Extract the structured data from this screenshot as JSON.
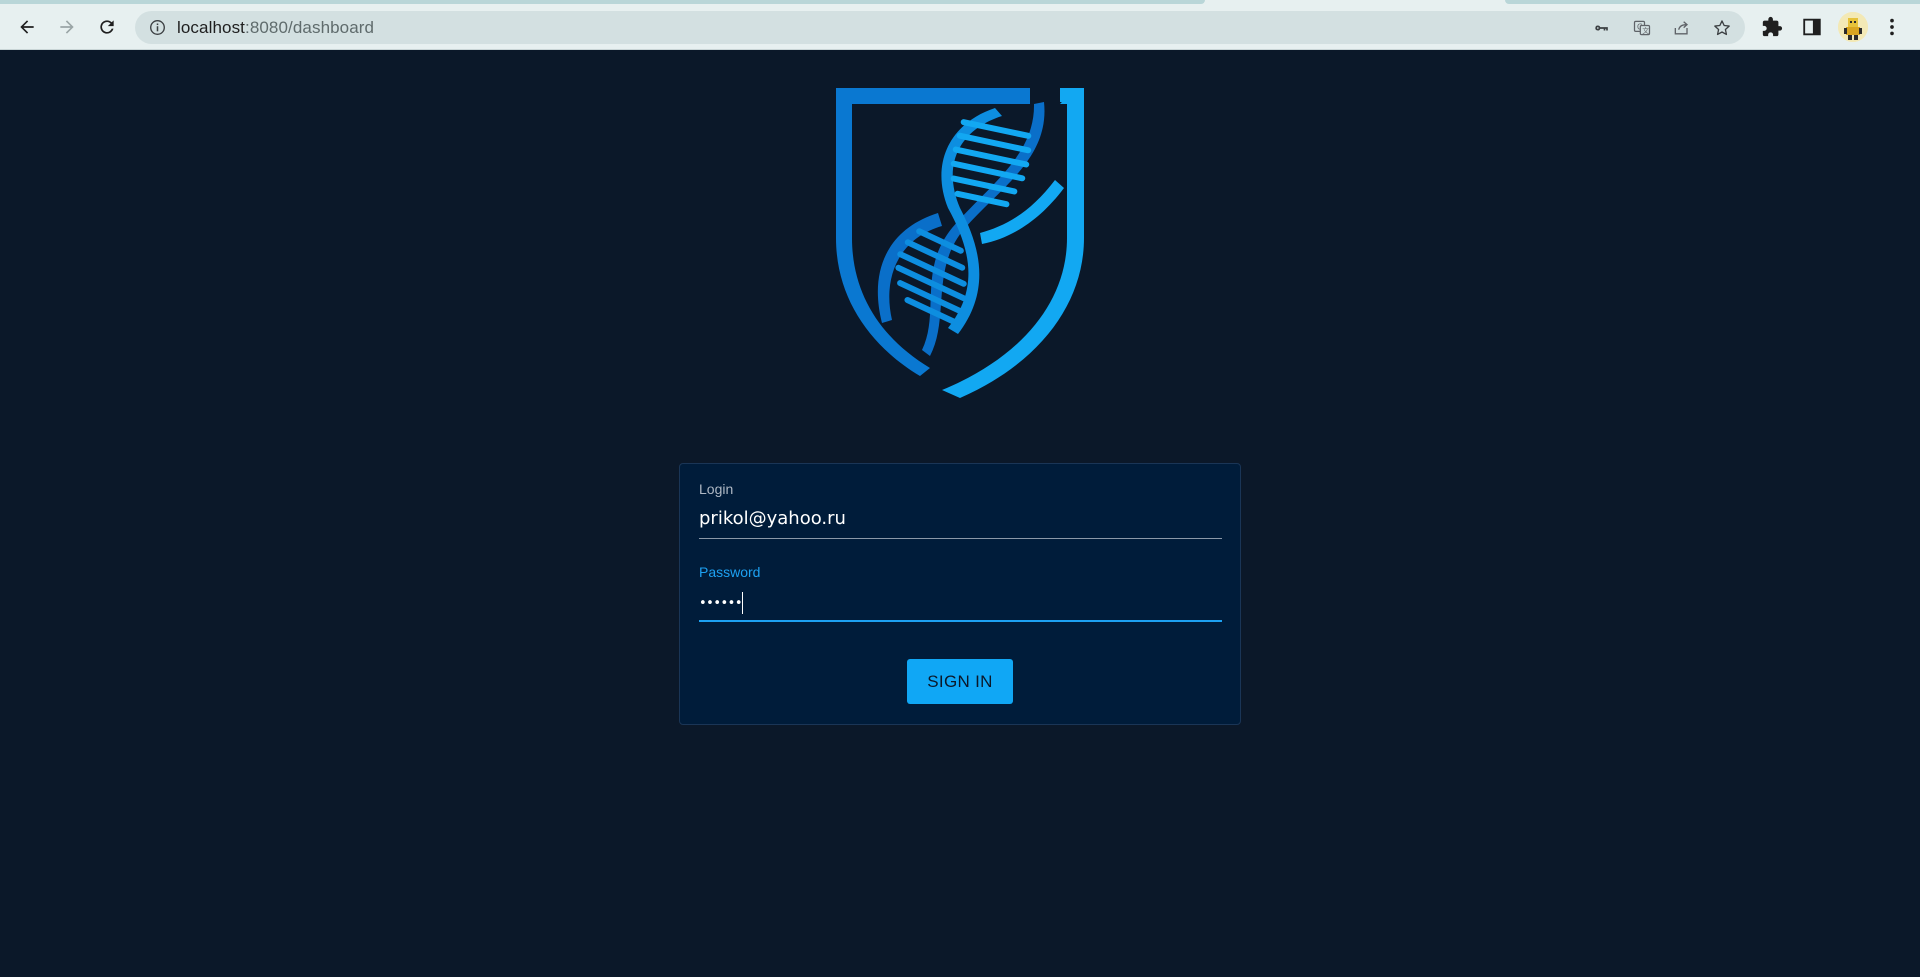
{
  "browser": {
    "url_host": "localhost",
    "url_path": ":8080/dashboard",
    "icons": {
      "back": "back-arrow-icon",
      "forward": "forward-arrow-icon",
      "reload": "reload-icon",
      "site_info": "info-icon",
      "passwords": "key-icon",
      "translate": "translate-icon",
      "share": "share-icon",
      "bookmark": "star-icon",
      "extensions": "puzzle-icon",
      "side_panel": "side-panel-icon",
      "profile": "avatar",
      "menu": "kebab-menu-icon"
    }
  },
  "login": {
    "logo": "dna-shield-logo",
    "login_label": "Login",
    "login_value": "prikol@yahoo.ru",
    "password_label": "Password",
    "password_masked": "••••••",
    "submit_label": "SIGN IN"
  },
  "colors": {
    "page_background": "#0b1829",
    "card_background": "#001c3a",
    "accent": "#10a7f5",
    "focus_label": "#1da1f2"
  }
}
